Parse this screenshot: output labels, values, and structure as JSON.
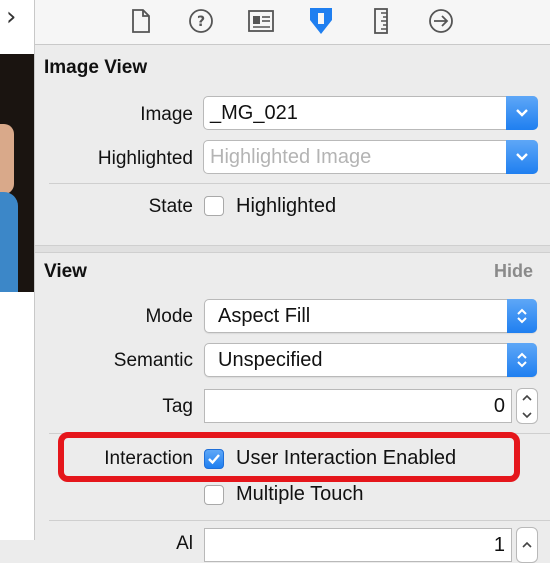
{
  "toolbar": {
    "icons": [
      "file-inspector-icon",
      "quick-help-icon",
      "identity-inspector-icon",
      "attributes-inspector-icon",
      "size-inspector-icon",
      "connections-inspector-icon"
    ],
    "active_color": "#1f7ff0"
  },
  "image_view": {
    "title": "Image View",
    "image_label": "Image",
    "image_value": "_MG_021",
    "highlighted_label": "Highlighted",
    "highlighted_placeholder": "Highlighted Image",
    "state_label": "State",
    "state_checkbox_label": "Highlighted"
  },
  "view": {
    "title": "View",
    "hide_label": "Hide",
    "mode_label": "Mode",
    "mode_value": "Aspect Fill",
    "semantic_label": "Semantic",
    "semantic_value": "Unspecified",
    "tag_label": "Tag",
    "tag_value": "0",
    "interaction_label": "Interaction",
    "user_interaction_label": "User Interaction Enabled",
    "user_interaction_checked": true,
    "multiple_touch_label": "Multiple Touch",
    "multiple_touch_checked": false,
    "cut_row_label": "Al",
    "cut_row_value": "1"
  },
  "annotation_color": "#e5161b"
}
